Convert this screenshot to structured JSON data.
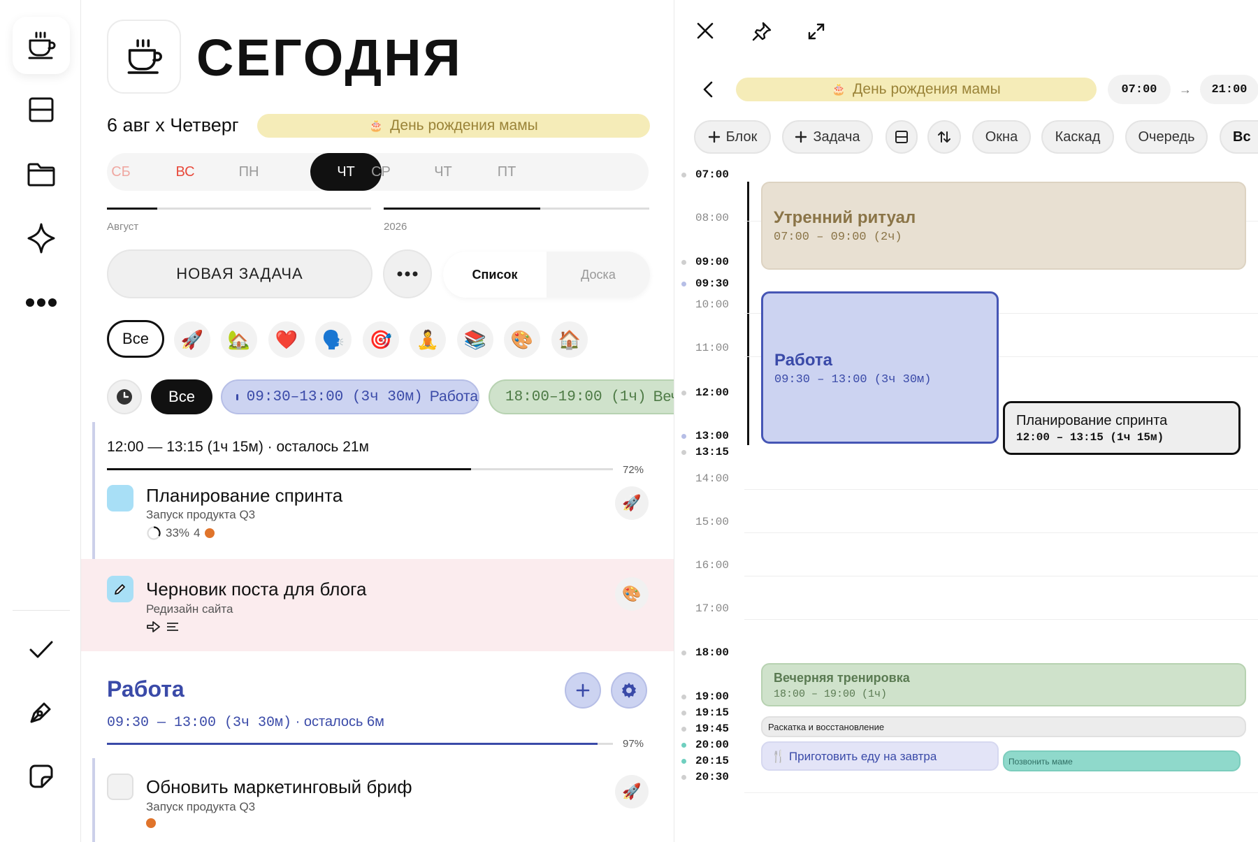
{
  "sidebar": {
    "items": [
      "coffee-icon",
      "layout-icon",
      "folder-icon",
      "sparkle-icon",
      "more-icon",
      "check-icon",
      "pen-icon",
      "note-icon"
    ]
  },
  "header": {
    "title": "СЕГОДНЯ",
    "date": "6 авг х Четверг",
    "event": "День рождения мамы"
  },
  "week": {
    "days": [
      "СБ",
      "ВС",
      "ПН",
      "ЧТ",
      "СР",
      "ЧТ",
      "ПТ"
    ],
    "active_index": 3,
    "month_label": "Август",
    "year_label": "2026"
  },
  "actions": {
    "new_task": "НОВАЯ ЗАДАЧА",
    "view_list": "Список",
    "view_board": "Доска"
  },
  "filters": {
    "all_label": "Все",
    "categories": [
      "🚀",
      "🏡",
      "❤️",
      "🗣️",
      "🎯",
      "🧘",
      "📚",
      "🎨",
      "🏠"
    ]
  },
  "time_filters": {
    "all_label": "Все",
    "work": {
      "time": "09:30–13:00 (3ч 30м)",
      "label": "Работа"
    },
    "evening": {
      "time": "18:00–19:00 (1ч)",
      "label": "Вечер"
    }
  },
  "current": {
    "time": "12:00 — 13:15 (1ч 15м) · осталось 21м",
    "progress_text": "72%",
    "progress": 0.72
  },
  "tasks": [
    {
      "title": "Планирование спринта",
      "project": "Запуск продукта Q3",
      "progress": "33%",
      "count": "4",
      "emoji": "🚀"
    },
    {
      "title": "Черновик поста для блога",
      "project": "Редизайн сайта",
      "emoji": "🎨"
    },
    {
      "title": "Обновить маркетинговый бриф",
      "project": "Запуск продукта Q3",
      "emoji": "🚀"
    }
  ],
  "work_section": {
    "title": "Работа",
    "time": "09:30 — 13:00 (3ч 30м)",
    "rest": " · осталось 6м",
    "progress_text": "97%",
    "progress": 0.97
  },
  "right": {
    "event": "День рождения мамы",
    "start": "07:00",
    "end": "21:00",
    "toolbar": {
      "block": "Блок",
      "task": "Задача",
      "windows": "Окна",
      "cascade": "Каскад",
      "queue": "Очередь",
      "more": "Вс"
    },
    "hours": [
      "07:00",
      "08:00",
      "09:00",
      "09:30",
      "10:00",
      "11:00",
      "12:00",
      "13:00",
      "13:15",
      "14:00",
      "15:00",
      "16:00",
      "17:00",
      "18:00",
      "19:00",
      "19:15",
      "19:45",
      "20:00",
      "20:15",
      "20:30"
    ],
    "blocks": {
      "morning": {
        "title": "Утренний ритуал",
        "time": "07:00 – 09:00 (2ч)"
      },
      "work": {
        "title": "Работа",
        "time": "09:30 – 13:00 (3ч 30м)"
      },
      "sprint": {
        "title": "Планирование спринта",
        "time": "12:00 – 13:15 (1ч 15м)"
      },
      "evening": {
        "title": "Вечерняя тренировка",
        "time": "18:00 – 19:00 (1ч)"
      },
      "recovery": {
        "title": "Раскатка и восстановление"
      },
      "food": {
        "title": "Приготовить еду на завтра"
      },
      "call": {
        "title": "Позвонить маме"
      }
    }
  },
  "colors": {
    "accent": "#3a4aa8",
    "bday": "#f5ecb8",
    "work": "#ccd3f1",
    "evening": "#cfe2cb",
    "morning": "#e8e0d2"
  }
}
